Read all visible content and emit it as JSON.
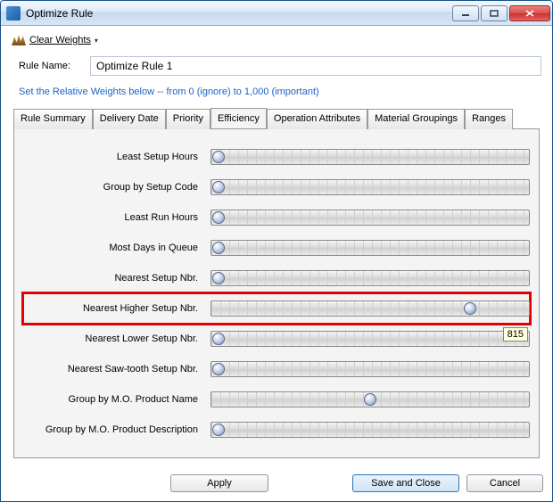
{
  "window": {
    "title": "Optimize Rule"
  },
  "toolbar": {
    "clear_weights": "Clear Weights"
  },
  "rule": {
    "label": "Rule Name:",
    "value": "Optimize Rule 1"
  },
  "hint": "Set the Relative Weights below -- from 0 (ignore) to 1,000 (important)",
  "tabs": [
    {
      "label": "Rule Summary"
    },
    {
      "label": "Delivery Date"
    },
    {
      "label": "Priority"
    },
    {
      "label": "Efficiency"
    },
    {
      "label": "Operation Attributes"
    },
    {
      "label": "Material Groupings"
    },
    {
      "label": "Ranges"
    }
  ],
  "active_tab": 3,
  "sliders": [
    {
      "label": "Least Setup Hours",
      "value": 0,
      "max": 1000,
      "highlight": false
    },
    {
      "label": "Group by Setup Code",
      "value": 0,
      "max": 1000,
      "highlight": false
    },
    {
      "label": "Least Run Hours",
      "value": 0,
      "max": 1000,
      "highlight": false
    },
    {
      "label": "Most Days in Queue",
      "value": 0,
      "max": 1000,
      "highlight": false
    },
    {
      "label": "Nearest Setup Nbr.",
      "value": 0,
      "max": 1000,
      "highlight": false
    },
    {
      "label": "Nearest Higher Setup Nbr.",
      "value": 815,
      "max": 1000,
      "highlight": true
    },
    {
      "label": "Nearest Lower Setup Nbr.",
      "value": 0,
      "max": 1000,
      "highlight": false,
      "tooltip": "815"
    },
    {
      "label": "Nearest Saw-tooth Setup Nbr.",
      "value": 0,
      "max": 1000,
      "highlight": false
    },
    {
      "label": "Group by M.O. Product Name",
      "value": 500,
      "max": 1000,
      "highlight": false
    },
    {
      "label": "Group by M.O. Product Description",
      "value": 0,
      "max": 1000,
      "highlight": false
    }
  ],
  "buttons": {
    "apply": "Apply",
    "save": "Save and Close",
    "cancel": "Cancel"
  }
}
